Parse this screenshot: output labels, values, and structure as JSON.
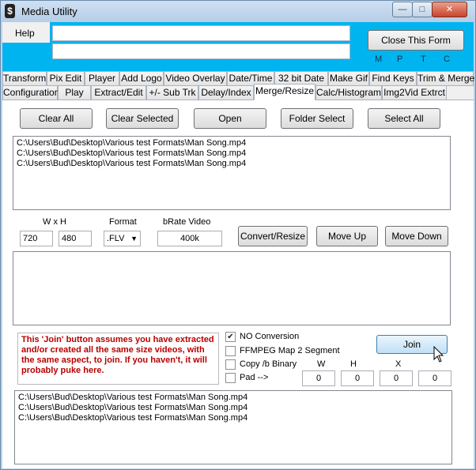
{
  "window": {
    "title": "Media Utility",
    "icon_glyph": "$",
    "minimize_glyph": "—",
    "maximize_glyph": "□",
    "close_glyph": "✕"
  },
  "menu": {
    "help": "Help"
  },
  "top_fields": {
    "field1": "",
    "field2": ""
  },
  "close_form": {
    "label": "Close This Form"
  },
  "indicators": [
    "M",
    "P",
    "T",
    "C"
  ],
  "tabs_row1": [
    "Transform",
    "Pix Edit",
    "Player",
    "Add Logo",
    "Video Overlay",
    "Date/Time",
    "32 bit Date",
    "Make Gif",
    "Find Keys",
    "Trim & Merge"
  ],
  "tabs_row2": [
    "Configuration",
    "Play",
    "Extract/Edit",
    "+/- Sub Trk",
    "Delay/Index",
    "Merge/Resize",
    "Calc/Histogram",
    "Img2Vid Extrct"
  ],
  "active_tab": "Merge/Resize",
  "buttons": {
    "clear_all": "Clear All",
    "clear_selected": "Clear Selected",
    "open": "Open",
    "folder_select": "Folder Select",
    "select_all": "Select All",
    "convert_resize": "Convert/Resize",
    "move_up": "Move Up",
    "move_down": "Move Down",
    "join": "Join"
  },
  "file_list_top": [
    "C:\\Users\\Bud\\Desktop\\Various test Formats\\Man Song.mp4",
    "C:\\Users\\Bud\\Desktop\\Various test Formats\\Man Song.mp4",
    "C:\\Users\\Bud\\Desktop\\Various test Formats\\Man Song.mp4"
  ],
  "resize": {
    "wxh_label": "W x H",
    "width": "720",
    "height": "480",
    "format_label": "Format",
    "format_value": ".FLV",
    "bitrate_label": "bRate Video",
    "bitrate_value": "400k"
  },
  "note": "This 'Join' button assumes you have extracted  and/or created all the same size videos, with the same aspect,  to join.  If you haven't, it will probably puke here.",
  "options": {
    "no_conversion": {
      "label": "NO Conversion",
      "checked": true
    },
    "ffmpeg_map": {
      "label": "FFMPEG Map 2 Segment",
      "checked": false
    },
    "copy_binary": {
      "label": "Copy /b Binary",
      "checked": false
    },
    "pad": {
      "label": "Pad  -->",
      "checked": false
    }
  },
  "pad_fields": {
    "w_label": "W",
    "w_value": "0",
    "h_label": "H",
    "h_value": "0",
    "x_label": "X",
    "x_value": "0",
    "y_value": "0"
  },
  "file_list_bottom": [
    "C:\\Users\\Bud\\Desktop\\Various test Formats\\Man Song.mp4",
    "C:\\Users\\Bud\\Desktop\\Various test Formats\\Man Song.mp4",
    "C:\\Users\\Bud\\Desktop\\Various test Formats\\Man Song.mp4"
  ],
  "colors": {
    "accent_band": "#00b4f0",
    "note_text": "#b80000",
    "window_frame": "#bcd3ea"
  }
}
